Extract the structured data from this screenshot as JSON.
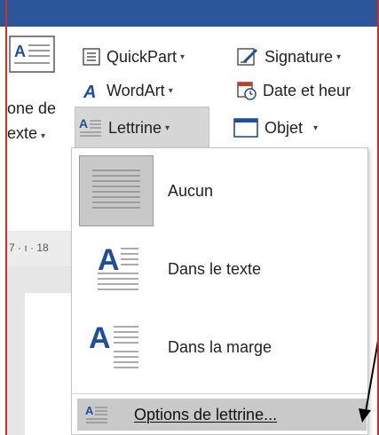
{
  "ribbon": {
    "quickpart_label": "QuickPart",
    "signature_label": "Signature",
    "wordart_label": "WordArt",
    "date_label": "Date et heur",
    "lettrine_label": "Lettrine",
    "objet_label": "Objet",
    "zone_line1": "one de",
    "zone_line2": "exte"
  },
  "ruler": {
    "marks": "7 · ı · 18"
  },
  "menu": {
    "items": [
      {
        "label": "Aucun",
        "icon": "no-dropcap-icon"
      },
      {
        "label": "Dans le texte",
        "icon": "dropcap-in-text-icon"
      },
      {
        "label": "Dans la marge",
        "icon": "dropcap-in-margin-icon"
      }
    ],
    "options_label": "Options de lettrine..."
  },
  "colors": {
    "title_bar": "#2b579a",
    "accent_blue": "#1f4e9c",
    "annotation_red": "#d62b2b",
    "hover_gray": "#c9c9c9"
  }
}
